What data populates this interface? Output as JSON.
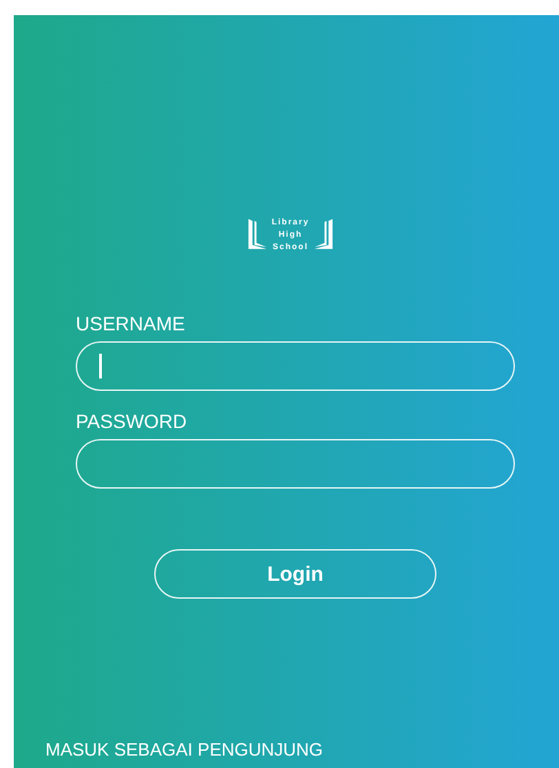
{
  "logo": {
    "lines": [
      "Library",
      "High",
      "School"
    ]
  },
  "fields": [
    {
      "label": "USERNAME",
      "focused": true
    },
    {
      "label": "PASSWORD",
      "focused": false
    }
  ],
  "login_button": "Login",
  "visitor_link": "MASUK SEBAGAI PENGUNJUNG"
}
